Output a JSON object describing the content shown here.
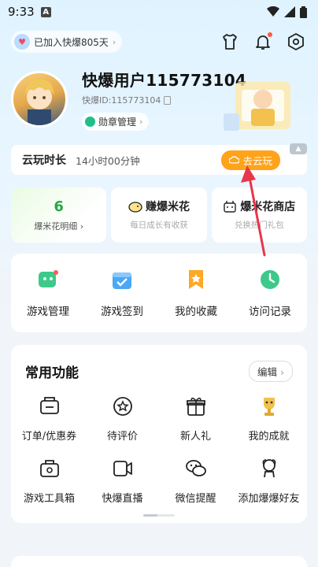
{
  "status_bar": {
    "time": "9:33",
    "app_indicator": "A"
  },
  "header": {
    "joined_label": "已加入快爆805天",
    "icons": [
      "shirt-icon",
      "bell-icon",
      "settings-hexagon-icon"
    ]
  },
  "profile": {
    "username": "快爆用户115773104",
    "user_id": "快爆ID:115773104",
    "badge_management": "勋章管理"
  },
  "cloud_play": {
    "title": "云玩时长",
    "duration": "14小时00分钟",
    "button_label": "去云玩"
  },
  "quick_cards": [
    {
      "value": "6",
      "subtitle": "爆米花明细"
    },
    {
      "title": "赚爆米花",
      "subtitle": "每日成长有收获"
    },
    {
      "title": "爆米花商店",
      "subtitle": "兑换热门礼包"
    }
  ],
  "shortcuts": [
    {
      "label": "游戏管理",
      "icon": "game-manage-icon"
    },
    {
      "label": "游戏签到",
      "icon": "checkin-icon"
    },
    {
      "label": "我的收藏",
      "icon": "favorite-icon"
    },
    {
      "label": "访问记录",
      "icon": "history-icon"
    }
  ],
  "common_functions": {
    "title": "常用功能",
    "edit_label": "编辑",
    "items": [
      {
        "label": "订单/优惠券",
        "icon": "coupon-icon"
      },
      {
        "label": "待评价",
        "icon": "review-icon"
      },
      {
        "label": "新人礼",
        "icon": "gift-icon"
      },
      {
        "label": "我的成就",
        "icon": "trophy-icon"
      },
      {
        "label": "游戏工具箱",
        "icon": "toolbox-icon"
      },
      {
        "label": "快爆直播",
        "icon": "live-icon"
      },
      {
        "label": "微信提醒",
        "icon": "wechat-icon"
      },
      {
        "label": "添加爆爆好友",
        "icon": "add-friend-icon"
      }
    ]
  },
  "colors": {
    "accent_orange": "#ffa31a",
    "green": "#27a844",
    "annotation_red": "#e8364a"
  }
}
